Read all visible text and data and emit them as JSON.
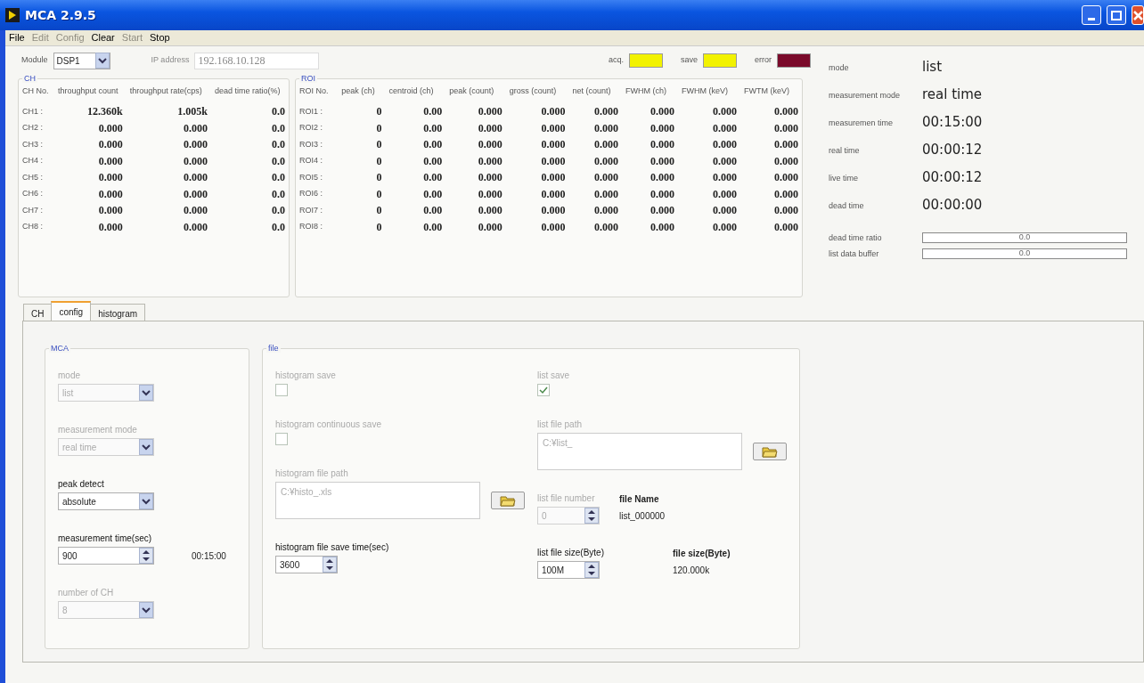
{
  "window": {
    "title": "MCA 2.9.5"
  },
  "menu": [
    {
      "label": "File",
      "disabled": false
    },
    {
      "label": "Edit",
      "disabled": true
    },
    {
      "label": "Config",
      "disabled": true
    },
    {
      "label": "Clear",
      "disabled": false
    },
    {
      "label": "Start",
      "disabled": true
    },
    {
      "label": "Stop",
      "disabled": false
    }
  ],
  "module": {
    "label": "Module",
    "value": "DSP1"
  },
  "ip_address": {
    "label": "IP address",
    "value": "192.168.10.128",
    "disabled": true
  },
  "indicators": [
    {
      "label": "acq.",
      "color": "#f2f200"
    },
    {
      "label": "save",
      "color": "#f2f200"
    },
    {
      "label": "error",
      "color": "#7a0a2a"
    }
  ],
  "ch_panel": {
    "title": "CH",
    "columns": [
      "CH No.",
      "throughput count",
      "throughput rate(cps)",
      "dead time ratio(%)"
    ],
    "rows": [
      [
        "CH1 :",
        "12.360k",
        "1.005k",
        "0.0"
      ],
      [
        "CH2 :",
        "0.000",
        "0.000",
        "0.0"
      ],
      [
        "CH3 :",
        "0.000",
        "0.000",
        "0.0"
      ],
      [
        "CH4 :",
        "0.000",
        "0.000",
        "0.0"
      ],
      [
        "CH5 :",
        "0.000",
        "0.000",
        "0.0"
      ],
      [
        "CH6 :",
        "0.000",
        "0.000",
        "0.0"
      ],
      [
        "CH7 :",
        "0.000",
        "0.000",
        "0.0"
      ],
      [
        "CH8 :",
        "0.000",
        "0.000",
        "0.0"
      ]
    ]
  },
  "roi_panel": {
    "title": "ROI",
    "columns": [
      "ROI No.",
      "peak (ch)",
      "centroid (ch)",
      "peak (count)",
      "gross (count)",
      "net (count)",
      "FWHM (ch)",
      "FWHM (keV)",
      "FWTM (keV)"
    ],
    "rows": [
      [
        "ROI1 :",
        "0",
        "0.00",
        "0.000",
        "0.000",
        "0.000",
        "0.000",
        "0.000",
        "0.000"
      ],
      [
        "ROI2 :",
        "0",
        "0.00",
        "0.000",
        "0.000",
        "0.000",
        "0.000",
        "0.000",
        "0.000"
      ],
      [
        "ROI3 :",
        "0",
        "0.00",
        "0.000",
        "0.000",
        "0.000",
        "0.000",
        "0.000",
        "0.000"
      ],
      [
        "ROI4 :",
        "0",
        "0.00",
        "0.000",
        "0.000",
        "0.000",
        "0.000",
        "0.000",
        "0.000"
      ],
      [
        "ROI5 :",
        "0",
        "0.00",
        "0.000",
        "0.000",
        "0.000",
        "0.000",
        "0.000",
        "0.000"
      ],
      [
        "ROI6 :",
        "0",
        "0.00",
        "0.000",
        "0.000",
        "0.000",
        "0.000",
        "0.000",
        "0.000"
      ],
      [
        "ROI7 :",
        "0",
        "0.00",
        "0.000",
        "0.000",
        "0.000",
        "0.000",
        "0.000",
        "0.000"
      ],
      [
        "ROI8 :",
        "0",
        "0.00",
        "0.000",
        "0.000",
        "0.000",
        "0.000",
        "0.000",
        "0.000"
      ]
    ]
  },
  "status": [
    {
      "label": "mode",
      "value": "list"
    },
    {
      "label": "measurement mode",
      "value": "real time"
    },
    {
      "label": "measuremen time",
      "value": "00:15:00"
    },
    {
      "label": "real time",
      "value": "00:00:12"
    },
    {
      "label": "live time",
      "value": "00:00:12"
    },
    {
      "label": "dead time",
      "value": "00:00:00"
    }
  ],
  "meters": [
    {
      "label": "dead time ratio",
      "reading": "0.0",
      "level": 0
    },
    {
      "label": "list data buffer",
      "reading": "0.0",
      "level": 0
    }
  ],
  "tabs": [
    {
      "label": "CH",
      "selected": false
    },
    {
      "label": "config",
      "selected": true
    },
    {
      "label": "histogram",
      "selected": false
    }
  ],
  "mca": {
    "title": "MCA",
    "fields": [
      {
        "kind": "dropdown",
        "label": "mode",
        "value": "list",
        "disabled": true
      },
      {
        "kind": "dropdown",
        "label": "measurement mode",
        "value": "real time",
        "disabled": true
      },
      {
        "kind": "dropdown",
        "label": "peak detect",
        "value": "absolute",
        "disabled": false
      },
      {
        "kind": "spin",
        "label": "measurement time(sec)",
        "value": "900",
        "disabled": false,
        "reading": "00:15:00"
      },
      {
        "kind": "dropdown",
        "label": "number of CH",
        "value": "8",
        "disabled": true
      }
    ]
  },
  "file": {
    "title": "file",
    "left": [
      {
        "kind": "checkbox",
        "label": "histogram save",
        "checked": false,
        "disabled": true
      },
      {
        "kind": "checkbox",
        "label": "histogram continuous save",
        "checked": false,
        "disabled": true
      },
      {
        "kind": "path",
        "label": "histogram file path",
        "value": "C:¥histo_.xls",
        "disabled": true
      },
      {
        "kind": "spin",
        "label": "histogram file save time(sec)",
        "value": "3600",
        "disabled": false
      }
    ],
    "right": [
      {
        "kind": "checkbox",
        "label": "list save",
        "checked": true,
        "disabled": true
      },
      {
        "kind": "path",
        "label": "list file path",
        "value": "C:¥list_",
        "disabled": true
      },
      {
        "kind": "spin",
        "label": "list file number",
        "value": "0",
        "disabled": true,
        "info": {
          "label": "file Name",
          "value": "list_000000"
        }
      },
      {
        "kind": "spin",
        "label": "list file size(Byte)",
        "value": "100M",
        "disabled": false,
        "info": {
          "label": "file size(Byte)",
          "value": "120.000k"
        }
      }
    ]
  }
}
